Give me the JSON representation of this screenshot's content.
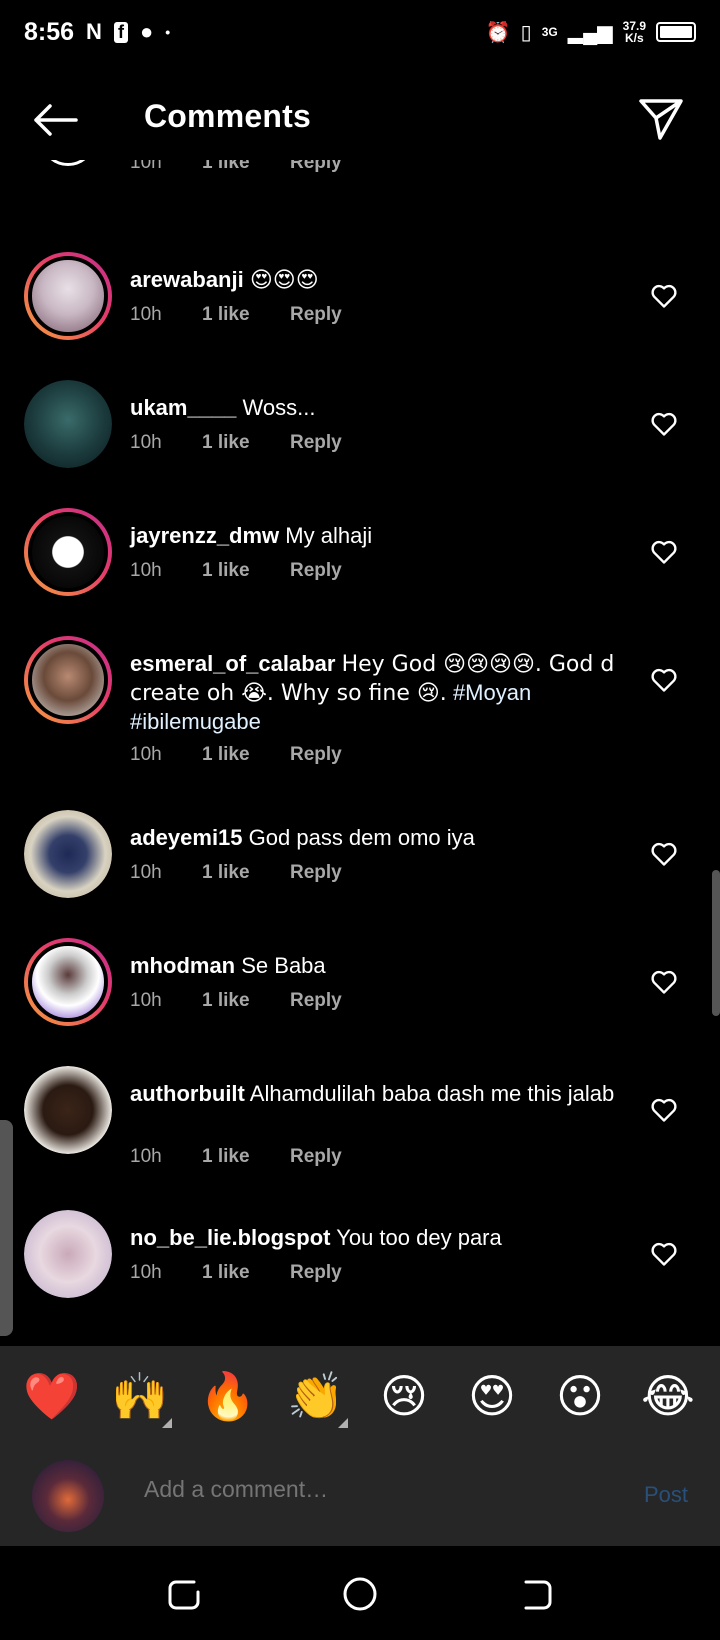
{
  "status_bar": {
    "time": "8:56",
    "net_label": "3G",
    "speed_value": "37.9",
    "speed_unit": "K/s"
  },
  "header": {
    "title": "Comments"
  },
  "partial_comment": {
    "time": "10h",
    "likes": "1 like",
    "reply": "Reply"
  },
  "comments": [
    {
      "username": "arewabanji",
      "text": "😍😍😍",
      "time": "10h",
      "likes": "1 like",
      "reply": "Reply"
    },
    {
      "username": "ukam____",
      "text": "Woss...",
      "time": "10h",
      "likes": "1 like",
      "reply": "Reply"
    },
    {
      "username": "jayrenzz_dmw",
      "text": "My alhaji",
      "time": "10h",
      "likes": "1 like",
      "reply": "Reply"
    },
    {
      "username": "esmeral_of_calabar",
      "text": "Hey God 😢😢😢😢. God d create oh 😭. Why so fine 😢.",
      "hashtag1": "#Moyan",
      "hashtag2": "#ibilemugabe",
      "time": "10h",
      "likes": "1 like",
      "reply": "Reply"
    },
    {
      "username": "adeyemi15",
      "text": "God pass dem omo iya",
      "time": "10h",
      "likes": "1 like",
      "reply": "Reply"
    },
    {
      "username": "mhodman",
      "text": "Se Baba",
      "time": "10h",
      "likes": "1 like",
      "reply": "Reply"
    },
    {
      "username": "authorbuilt",
      "text": "Alhamdulilah baba dash me this jalab",
      "time": "10h",
      "likes": "1 like",
      "reply": "Reply"
    },
    {
      "username": "no_be_lie.blogspot",
      "text": "You too dey para",
      "time": "10h",
      "likes": "1 like",
      "reply": "Reply"
    }
  ],
  "emoji_bar": [
    "❤️",
    "🙌",
    "🔥",
    "👏",
    "😢",
    "😍",
    "😮",
    "😂"
  ],
  "composer": {
    "placeholder": "Add a comment…",
    "post_label": "Post"
  },
  "colors": {
    "background": "#000000",
    "panel": "#262626",
    "meta_text": "#a8a8a8",
    "post_disabled": "#28507a",
    "story_ring_start": "#f9a13c",
    "story_ring_end": "#c52d8f"
  }
}
